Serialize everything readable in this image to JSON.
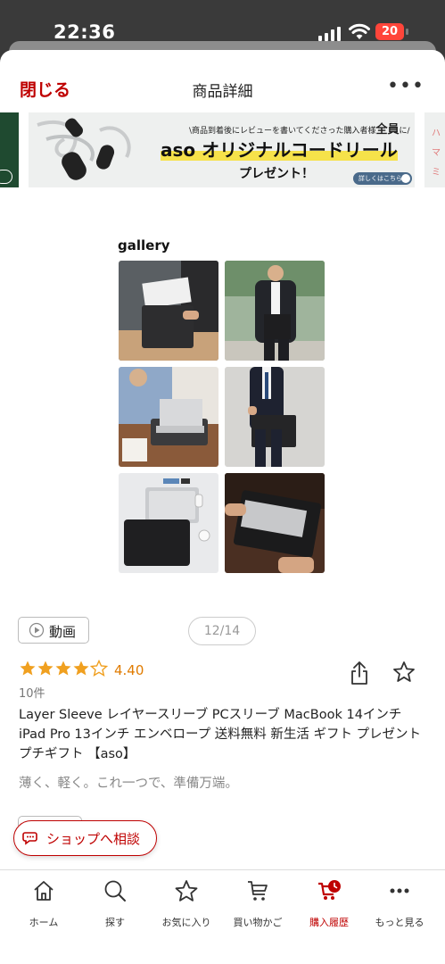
{
  "status_bar": {
    "time": "22:36",
    "battery": "20"
  },
  "header": {
    "close_label": "閉じる",
    "title": "商品詳細",
    "more_label": "•••"
  },
  "banner": {
    "note_prefix": "\\商品到着後にレビューを書いてくださった購入者様",
    "note_emph": "全員",
    "note_suffix": "に/",
    "brand": "aso",
    "headline": "オリジナルコードリール",
    "present": "プレゼント！",
    "button": "詳しくはこちら",
    "next_text": [
      "ハ",
      "マ",
      "ミ"
    ]
  },
  "gallery": {
    "label": "gallery"
  },
  "media": {
    "video_label": "動画",
    "counter": "12/14"
  },
  "product": {
    "rating_value": 4.4,
    "rating": "4.40",
    "review_count": "10件",
    "title": "Layer Sleeve レイヤースリーブ PCスリーブ MacBook 14インチ iPad Pro 13インチ エンベロープ 送料無料 新生活 ギフト プレゼント プチギフト 【aso】",
    "catchcopy": "薄く、軽く。これ一つで、準備万端。"
  },
  "consult": {
    "label": "ショップへ相談"
  },
  "bottom_nav": {
    "items": [
      {
        "label": "ホーム",
        "icon": "home-icon"
      },
      {
        "label": "探す",
        "icon": "search-icon"
      },
      {
        "label": "お気に入り",
        "icon": "star-icon"
      },
      {
        "label": "買い物かご",
        "icon": "cart-icon"
      },
      {
        "label": "購入履歴",
        "icon": "purchase-history-icon",
        "active": true
      },
      {
        "label": "もっと見る",
        "icon": "more-icon"
      }
    ]
  },
  "colors": {
    "accent": "#bf0000",
    "rating": "#e07b00",
    "star": "#f0a020"
  }
}
